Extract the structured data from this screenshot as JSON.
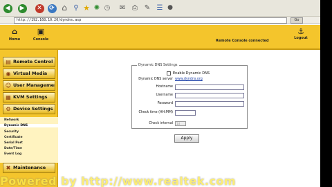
{
  "browser": {
    "back_label": "◀",
    "forward_label": "▶",
    "stop_label": "✕",
    "refresh_label": "⟳",
    "home_label": "⌂",
    "url": "http://192.168.10.20/dyndns.asp",
    "go_label": "Go",
    "accent": "#2e8b2e"
  },
  "header": {
    "home_label": "Home",
    "console_label": "Console",
    "remote_status": "Remote Console connected",
    "logout_label": "Logout",
    "brand_color": "#f4c52c"
  },
  "sidebar": {
    "menu": [
      {
        "label": "Remote Control",
        "icon": "monitor-icon"
      },
      {
        "label": "Virtual Media",
        "icon": "disk-icon"
      },
      {
        "label": "User Management",
        "icon": "users-icon"
      },
      {
        "label": "KVM Settings",
        "icon": "kvm-icon"
      },
      {
        "label": "Device Settings",
        "icon": "device-icon"
      }
    ],
    "submenu": [
      {
        "label": "Network",
        "active": false
      },
      {
        "label": "Dynamic DNS",
        "active": true
      },
      {
        "label": "Security",
        "active": false
      },
      {
        "label": "Certificate",
        "active": false
      },
      {
        "label": "Serial Port",
        "active": false
      },
      {
        "label": "Date/Time",
        "active": false
      },
      {
        "label": "Event Log",
        "active": false
      }
    ],
    "maintenance_label": "Maintenance"
  },
  "dns_settings": {
    "legend": "Dynamic DNS Settings",
    "enable_label": "Enable Dynamic DNS",
    "enabled": false,
    "server_label": "Dynamic DNS server",
    "server_value": "www.dyndns.org",
    "hostname_label": "Hostname",
    "hostname_value": "",
    "username_label": "Username",
    "username_value": "",
    "password_label": "Password",
    "password_value": "",
    "check_time_label": "Check time (HH:MM)",
    "check_time_value": "",
    "check_interval_label": "Check interval",
    "check_interval_value": "1d",
    "apply_label": "Apply"
  },
  "watermark": {
    "text": "Powered by  http://www.realtek.com"
  }
}
